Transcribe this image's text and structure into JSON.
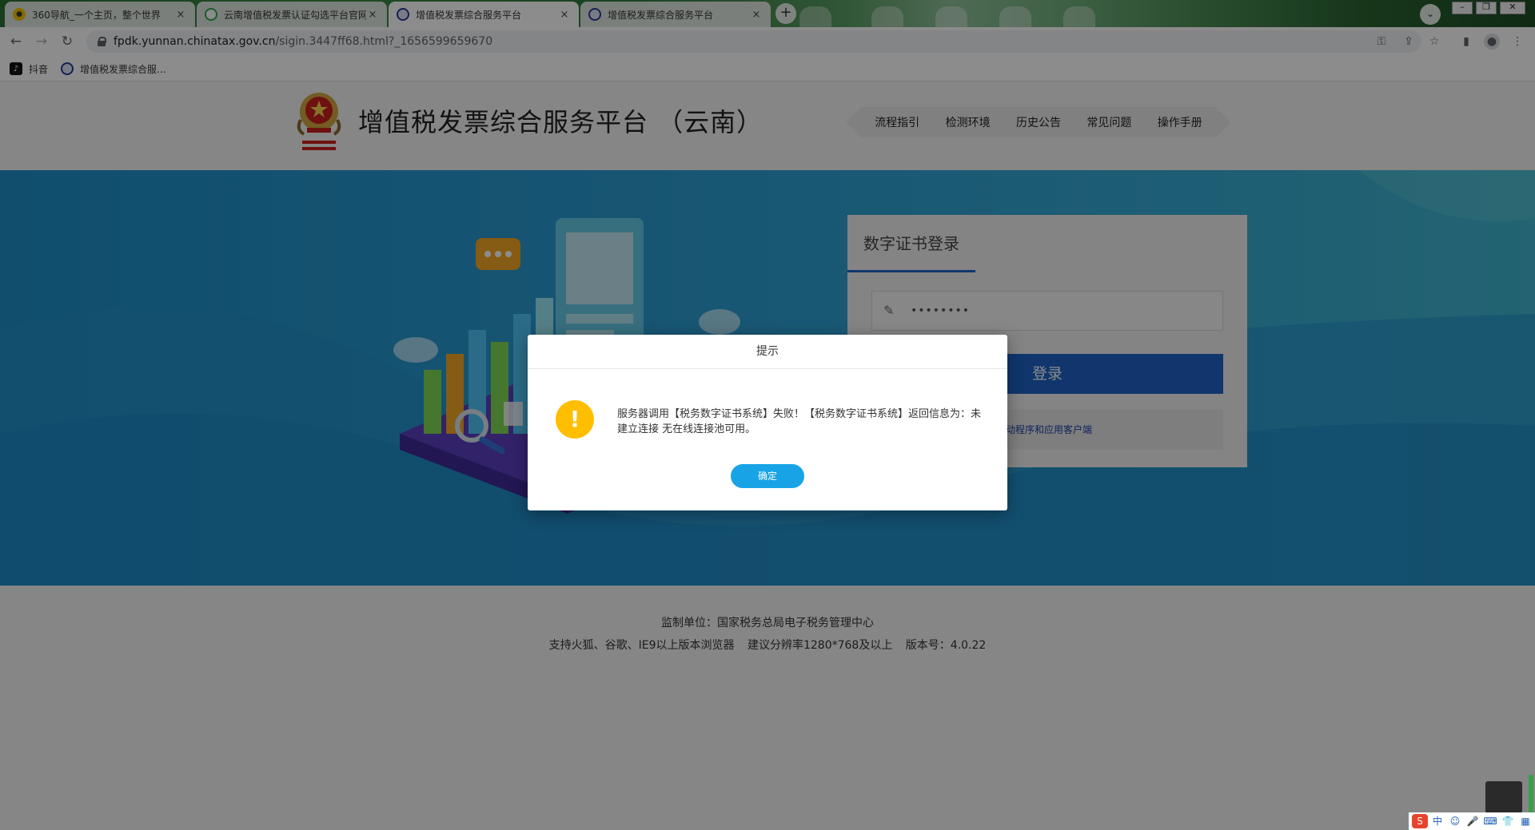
{
  "browser": {
    "tabs": [
      {
        "title": "360导航_一个主页，整个世界",
        "icon": "globe-360-icon",
        "color": "#f2c200",
        "active": false
      },
      {
        "title": "云南增值税发票认证勾选平台官网",
        "icon": "search-q-icon",
        "color": "#2fa84f",
        "active": false
      },
      {
        "title": "增值税发票综合服务平台",
        "icon": "tax-site-icon",
        "color": "#2d3a9b",
        "active": true
      },
      {
        "title": "增值税发票综合服务平台",
        "icon": "tax-site-icon",
        "color": "#2d3a9b",
        "active": false
      }
    ],
    "tab_close": "×",
    "new_tab": "+",
    "url_host": "fpdk.yunnan.chinatax.gov.cn",
    "url_path": "/sigin.3447ff68.html?_1656599659670",
    "bookmarks": [
      {
        "label": "抖音",
        "icon": "douyin-icon"
      },
      {
        "label": "增值税发票综合服...",
        "icon": "tax-site-icon"
      }
    ]
  },
  "header": {
    "site_title": "增值税发票综合服务平台 （云南）",
    "nav": [
      "流程指引",
      "检测环境",
      "历史公告",
      "常见问题",
      "操作手册"
    ]
  },
  "login": {
    "title": "数字证书登录",
    "password_value": "••••••••",
    "login_button": "登录",
    "driver_link": "动程序和应用客户端"
  },
  "footer": {
    "line1": "监制单位：国家税务总局电子税务管理中心",
    "line2": "支持火狐、谷歌、IE9以上版本浏览器   建议分辨率1280*768及以上   版本号：4.0.22"
  },
  "dialog": {
    "title": "提示",
    "message": "服务器调用【税务数字证书系统】失败！【税务数字证书系统】返回信息为：未建立连接 无在线连接池可用。",
    "icon_glyph": "!",
    "ok_button": "确定"
  },
  "ime": {
    "items": [
      "S",
      "中",
      "☺",
      "🎤",
      "⌨",
      "👕",
      "▦"
    ]
  },
  "colors": {
    "accent_blue": "#1e63c6",
    "hero_blue": "#2a9bd2",
    "warn_yellow": "#ffbe00",
    "ok_blue": "#18a3e6"
  }
}
